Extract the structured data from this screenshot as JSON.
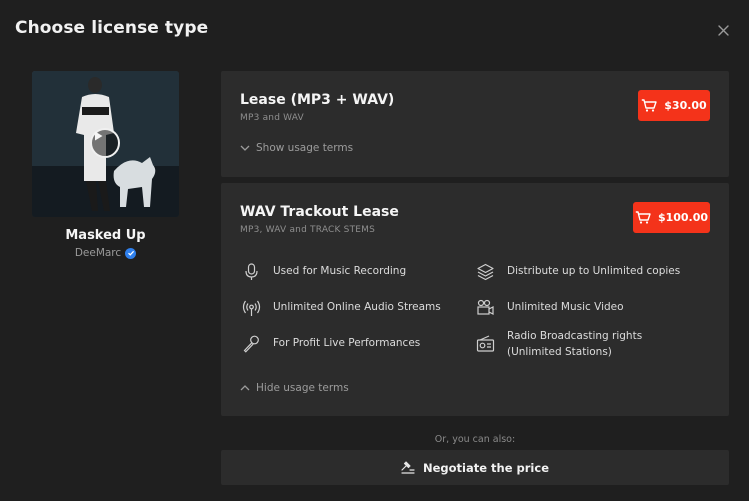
{
  "modal": {
    "title": "Choose license type"
  },
  "track": {
    "title": "Masked Up",
    "artist": "DeeMarc"
  },
  "licenses": [
    {
      "name": "Lease (MP3 + WAV)",
      "files": "MP3 and WAV",
      "price": "$30.00",
      "toggle_label": "Show usage terms"
    },
    {
      "name": "WAV Trackout Lease",
      "files": "MP3, WAV and TRACK STEMS",
      "price": "$100.00",
      "toggle_label": "Hide usage terms",
      "terms": [
        {
          "icon": "microphone-icon",
          "text": "Used for Music Recording"
        },
        {
          "icon": "layers-icon",
          "text": "Distribute up to Unlimited copies"
        },
        {
          "icon": "broadcast-icon",
          "text": "Unlimited Online Audio Streams"
        },
        {
          "icon": "video-camera-icon",
          "text": "Unlimited Music Video"
        },
        {
          "icon": "handheld-mic-icon",
          "text": "For Profit Live Performances"
        },
        {
          "icon": "radio-icon",
          "text": "Radio Broadcasting rights (Unlimited Stations)"
        }
      ]
    }
  ],
  "footer": {
    "alt_text": "Or, you can also:",
    "negotiate_label": "Negotiate the price"
  },
  "colors": {
    "background": "#1f1f1f",
    "card": "#2c2c2c",
    "price_button": "#f4331a",
    "verified_badge": "#2f80ed"
  }
}
